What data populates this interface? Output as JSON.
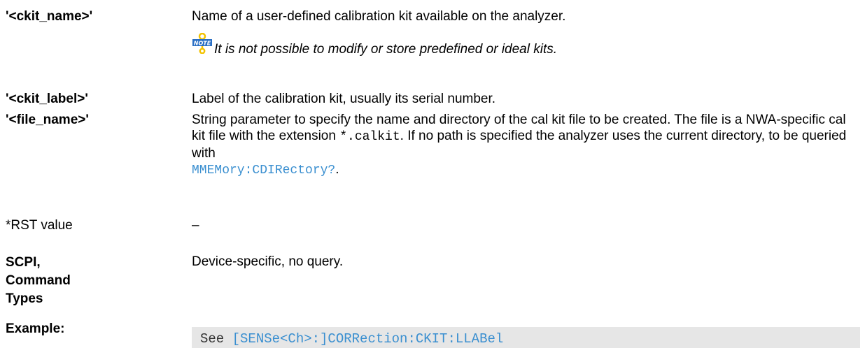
{
  "params": [
    {
      "label": "'<ckit_name>'",
      "desc": "Name of a user-defined calibration kit available on the analyzer."
    },
    {
      "label": "'<ckit_label>'",
      "desc": "Label of the calibration kit, usually its serial number."
    },
    {
      "label": "'<file_name>'",
      "desc_part1": "String parameter to specify the name and directory of the cal kit file to be created. The file is a NWA-specific cal kit file with the extension ",
      "desc_code": "*.calkit",
      "desc_part2": ". If no path is specified the analyzer uses the current directory, to be queried with",
      "desc_link": "MMEMory:CDIRectory?",
      "desc_end": "."
    }
  ],
  "note": {
    "icon_label": "NOTE",
    "text": "It is not possible to modify or store predefined or ideal kits."
  },
  "rst": {
    "label": "*RST value",
    "value": "–"
  },
  "scpi": {
    "label_line1": "SCPI,",
    "label_line2": "Command",
    "label_line3": "Types",
    "value": "Device-specific, no query."
  },
  "example": {
    "label": "Example:",
    "prefix": "See ",
    "link": "[SENSe<Ch>:]CORRection:CKIT:LLABel"
  },
  "colors": {
    "link": "#3a8fd0",
    "example_bg": "#e6e6e6",
    "note_icon_primary": "#2a6fc4",
    "note_icon_secondary": "#f2c200"
  }
}
